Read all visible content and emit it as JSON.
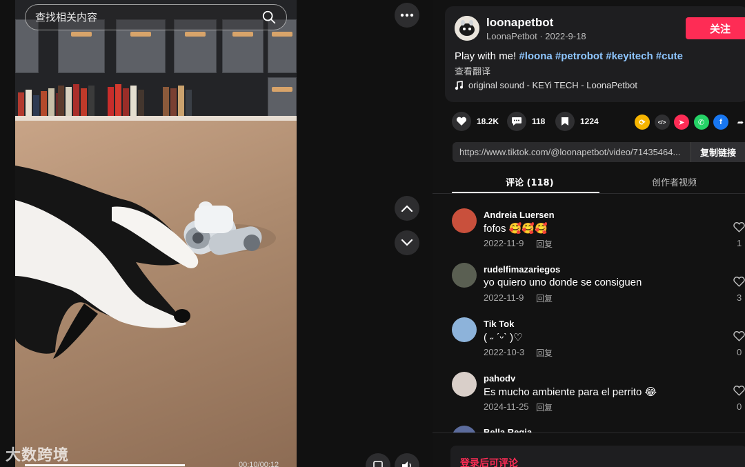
{
  "search": {
    "placeholder": "查找相关内容"
  },
  "player": {
    "watermark": "大数跨境",
    "time": "00:10/00:12",
    "progress_fraction": 0.83
  },
  "author": {
    "username": "loonapetbot",
    "meta": "LoonaPetbot · 2022-9-18",
    "follow_label": "关注"
  },
  "caption": {
    "prefix": "Play with me!",
    "hashtags": [
      "#loona",
      "#petrobot",
      "#keyitech",
      "#cute"
    ],
    "translate_label": "查看翻译"
  },
  "music": {
    "label": "original sound - KEYi TECH - LoonaPetbot"
  },
  "stats": {
    "likes": "18.2K",
    "comments": "118",
    "bookmarks": "1224"
  },
  "share_icons": [
    {
      "name": "repost-icon",
      "color": "#f7b500",
      "glyph": "⟳"
    },
    {
      "name": "embed-icon",
      "color": "#2f2f31",
      "glyph": "</>"
    },
    {
      "name": "send-to-friends-icon",
      "color": "#fe2c55",
      "glyph": "➤"
    },
    {
      "name": "whatsapp-icon",
      "color": "#25d366",
      "glyph": "✆"
    },
    {
      "name": "facebook-icon",
      "color": "#1877f2",
      "glyph": "f"
    },
    {
      "name": "share-arrow-icon",
      "color": "#121212",
      "glyph": "➦"
    }
  ],
  "link": {
    "url": "https://www.tiktok.com/@loonapetbot/video/71435464...",
    "copy_label": "复制链接"
  },
  "tabs": {
    "comments": "评论 (118)",
    "creator_videos": "创作者视频"
  },
  "comments": [
    {
      "user": "Andreia Luersen",
      "text": "fofos 🥰🥰🥰",
      "date": "2022-11-9",
      "reply": "回复",
      "likes": "1",
      "avatar_color": "#c9503c"
    },
    {
      "user": "rudelfimazariegos",
      "text": "yo quiero uno donde se consiguen",
      "date": "2022-11-9",
      "reply": "回复",
      "likes": "3",
      "avatar_color": "#5a5f52"
    },
    {
      "user": "Tik Tok",
      "text": "( ˶ ˊᵕˋ )♡",
      "date": "2022-10-3",
      "reply": "回复",
      "likes": "0",
      "avatar_color": "#8db3da"
    },
    {
      "user": "pahodv",
      "text": "Es mucho ambiente para el perrito 😂",
      "date": "2024-11-25",
      "reply": "回复",
      "likes": "0",
      "avatar_color": "#d9cfc9"
    },
    {
      "user": "Bella Regia",
      "text": "",
      "date": "",
      "reply": "",
      "likes": "",
      "avatar_color": "#5b6b9c"
    }
  ],
  "footer": {
    "login_label": "登录后可评论"
  },
  "colors": {
    "accent": "#fe2c55",
    "hashtag": "#8ec6ff",
    "panel": "#121212",
    "card": "#1e1e20"
  }
}
